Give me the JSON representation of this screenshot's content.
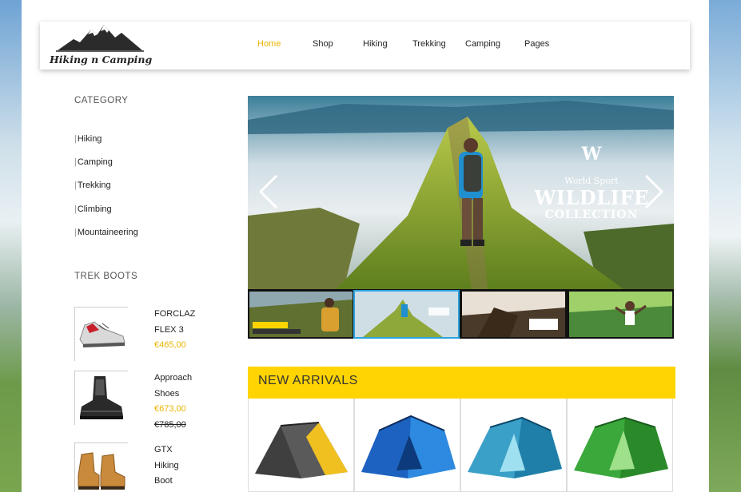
{
  "header": {
    "logo_text": "Hiking n Camping",
    "nav": [
      "Home",
      "Shop",
      "Hiking",
      "Trekking",
      "Camping",
      "Pages"
    ]
  },
  "sidebar": {
    "category_title": "CATEGORY",
    "categories": [
      "Hiking",
      "Camping",
      "Trekking",
      "Climbing",
      "Mountaineering"
    ],
    "boots_title": "TREK BOOTS",
    "products": [
      {
        "name_lines": [
          "FORCLAZ",
          "FLEX 3"
        ],
        "price": "€465,00",
        "old_price": ""
      },
      {
        "name_lines": [
          "Approach",
          "Shoes"
        ],
        "price": "€673,00",
        "old_price": "€785,00"
      },
      {
        "name_lines": [
          "GTX",
          "Hiking",
          "Boot"
        ],
        "price": "",
        "old_price": ""
      }
    ]
  },
  "slider": {
    "logo_letter": "W",
    "subtitle": "World Sport",
    "title": "WILDLIFE",
    "tagline": "COLLECTION"
  },
  "new_arrivals": {
    "title": "NEW ARRIVALS"
  },
  "colors": {
    "accent": "#ffd400",
    "active_nav": "#e8b400",
    "thumb_selected": "#2aa3e0"
  }
}
